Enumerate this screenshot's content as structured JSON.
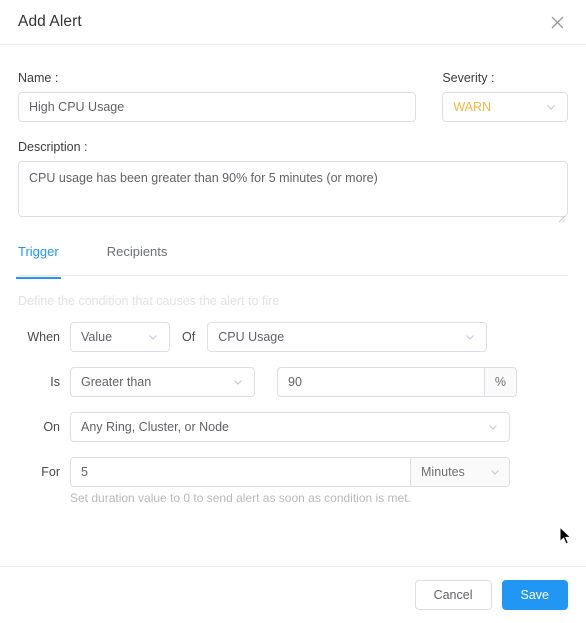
{
  "dialog": {
    "title": "Add Alert",
    "close_icon": "close-icon"
  },
  "name_field": {
    "label": "Name :",
    "value": "High CPU Usage",
    "placeholder": "Name"
  },
  "severity_field": {
    "label": "Severity :",
    "value": "WARN",
    "color": "#f2b544",
    "chevron_icon": "chevron-down-icon"
  },
  "description_field": {
    "label": "Description :",
    "value": "CPU usage has been greater than 90% for 5 minutes (or more)",
    "placeholder": "Description"
  },
  "tabs": [
    {
      "label": "Trigger",
      "active": true
    },
    {
      "label": "Recipients",
      "active": false
    }
  ],
  "trigger": {
    "hint": "Define the condition that causes the alert to fire",
    "when_label": "When",
    "when_value": "Value",
    "of_label": "Of",
    "of_value": "CPU Usage",
    "is_label": "Is",
    "is_value": "Greater than",
    "threshold_value": "90",
    "threshold_unit": "%",
    "on_label": "On",
    "on_value": "Any Ring, Cluster, or Node",
    "for_label": "For",
    "for_value": "5",
    "for_unit": "Minutes",
    "duration_hint": "Set duration value to 0 to send alert as soon as condition is met."
  },
  "footer": {
    "cancel_label": "Cancel",
    "save_label": "Save"
  },
  "theme": {
    "accent": "#2296f3",
    "warn": "#f2b544",
    "border": "#dcdfe6"
  }
}
